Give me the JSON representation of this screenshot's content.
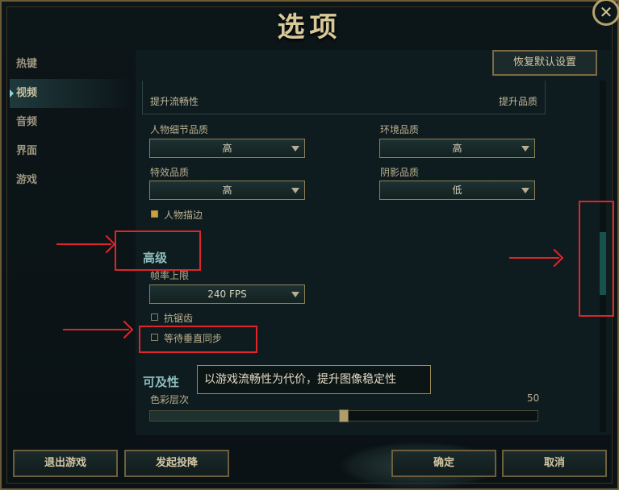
{
  "window": {
    "title": "选项",
    "close_glyph": "✕"
  },
  "sidebar": {
    "items": [
      {
        "label": "热键"
      },
      {
        "label": "视频"
      },
      {
        "label": "音频"
      },
      {
        "label": "界面"
      },
      {
        "label": "游戏"
      }
    ],
    "active_index": 1
  },
  "toolbar": {
    "restore_defaults": "恢复默认设置"
  },
  "preset": {
    "left_label": "提升流畅性",
    "right_label": "提升品质"
  },
  "quality": {
    "character_label": "人物细节品质",
    "character_value": "高",
    "environment_label": "环境品质",
    "environment_value": "高",
    "effects_label": "特效品质",
    "effects_value": "高",
    "shadows_label": "阴影品质",
    "shadows_value": "低"
  },
  "character_outline": {
    "label": "人物描边",
    "checked": true
  },
  "advanced": {
    "heading": "高级",
    "framerate_label": "帧率上限",
    "framerate_value": "240 FPS",
    "antialiasing": {
      "label": "抗锯齿",
      "checked": false
    },
    "vsync": {
      "label": "等待垂直同步",
      "checked": false
    }
  },
  "tooltip": {
    "text": "以游戏流畅性为代价，提升图像稳定性"
  },
  "accessibility": {
    "heading": "可及性",
    "color_depth_label": "色彩层次",
    "color_depth_value": "50",
    "color_depth_fraction": 0.5
  },
  "footer": {
    "exit_game": "退出游戏",
    "surrender": "发起投降",
    "ok": "确定",
    "cancel": "取消"
  },
  "scrollbar": {
    "position_fraction": 0.43
  },
  "colors": {
    "annotation_red": "#e0242a",
    "accent_gold": "#c7a240",
    "scroll_teal": "#17514d"
  }
}
